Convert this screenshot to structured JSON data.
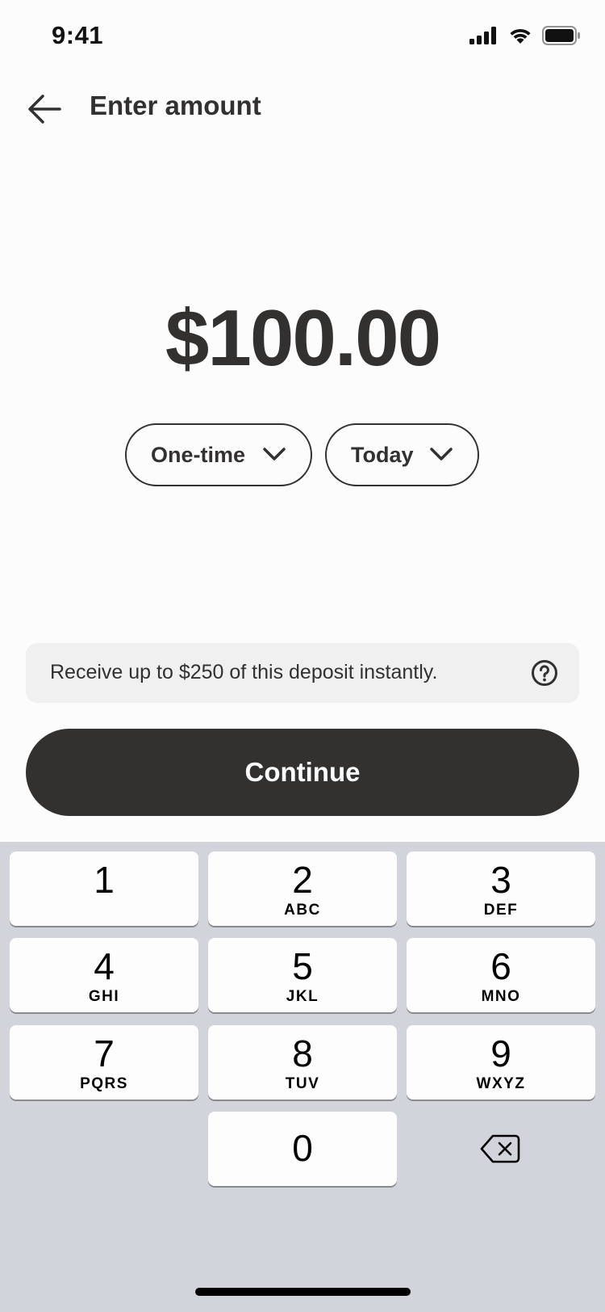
{
  "status_bar": {
    "time": "9:41",
    "icons": [
      "cellular-signal-icon",
      "wifi-icon",
      "battery-icon"
    ]
  },
  "header": {
    "back_icon": "arrow-left-icon",
    "title": "Enter amount"
  },
  "amount": {
    "value": "$100.00"
  },
  "options": {
    "frequency": {
      "selected": "One-time",
      "icon": "chevron-down-icon"
    },
    "date": {
      "selected": "Today",
      "icon": "chevron-down-icon"
    }
  },
  "info": {
    "text": "Receive up to $250 of this deposit instantly.",
    "icon": "question-circle-icon"
  },
  "continue_button": {
    "label": "Continue"
  },
  "keypad": {
    "keys": [
      {
        "digit": "1",
        "letters": ""
      },
      {
        "digit": "2",
        "letters": "ABC"
      },
      {
        "digit": "3",
        "letters": "DEF"
      },
      {
        "digit": "4",
        "letters": "GHI"
      },
      {
        "digit": "5",
        "letters": "JKL"
      },
      {
        "digit": "6",
        "letters": "MNO"
      },
      {
        "digit": "7",
        "letters": "PQRS"
      },
      {
        "digit": "8",
        "letters": "TUV"
      },
      {
        "digit": "9",
        "letters": "WXYZ"
      },
      {
        "digit": "0",
        "letters": ""
      }
    ],
    "delete_icon": "backspace-icon"
  },
  "colors": {
    "primary": "#333130",
    "background": "#fcfcfc",
    "info_background": "#f0f0f0",
    "keypad_background": "#d2d4db"
  }
}
